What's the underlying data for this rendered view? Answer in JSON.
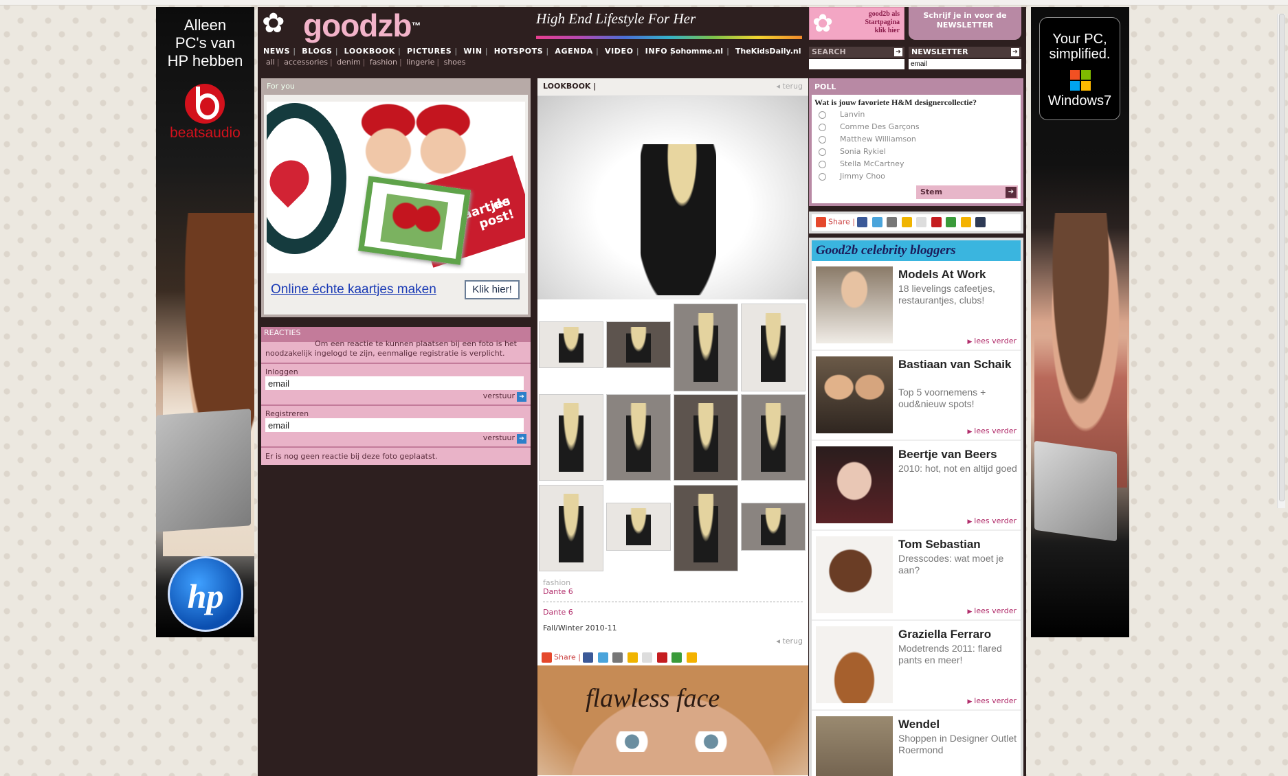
{
  "ad_left": {
    "headline": [
      "Alleen",
      "PC's van",
      "HP hebben"
    ],
    "beats_text": "beatsaudio",
    "hp_text": "hp"
  },
  "ad_right": {
    "line1": [
      "Your PC,",
      "simplified."
    ],
    "line2": "Windows7"
  },
  "header": {
    "logo": "goodzb",
    "logo_tm": "™",
    "tagline": "High End Lifestyle For Her",
    "nav": [
      "NEWS",
      "BLOGS",
      "LOOKBOOK",
      "PICTURES",
      "WIN",
      "HOTSPOTS",
      "AGENDA",
      "VIDEO",
      "INFO"
    ],
    "subnav": [
      "all",
      "accessories",
      "denim",
      "fashion",
      "lingerie",
      "shoes"
    ],
    "nav_right": [
      "Sohomme.nl",
      "TheKidsDaily.nl"
    ],
    "promo_start": [
      "good2b als",
      "Startpagina",
      "klik hier"
    ],
    "promo_newsletter": [
      "Schrijf je in voor de",
      "NEWSLETTER"
    ],
    "search_label": "SEARCH",
    "newsletter_label": "NEWSLETTER",
    "newsletter_value": "email"
  },
  "left": {
    "foryou_title": "For you",
    "card_text": [
      "kaartjes",
      "de post!"
    ],
    "ad_link": "Online échte kaartjes maken",
    "ad_button": "Klik hier!",
    "reacties_title": "REACTIES",
    "reacties_msg_right": "Om een reactie te kunnen plaatsen bij een foto is het",
    "reacties_msg_rest": "noodzakelijk ingelogd te zijn, eenmalige registratie is verplicht.",
    "login_label": "Inloggen",
    "login_value": "email",
    "login_send": "verstuur",
    "register_label": "Registreren",
    "register_value": "email",
    "register_send": "verstuur",
    "no_reactions": "Er is nog geen reactie bij deze foto geplaatst."
  },
  "middle": {
    "title": "LOOKBOOK |",
    "back": "terug",
    "category": "fashion",
    "link1": "Dante 6",
    "link2": "Dante 6",
    "season": "Fall/Winter 2010-11",
    "back2": "terug",
    "share_label": "Share",
    "flawless_title": "flawless face"
  },
  "right": {
    "poll_title": "POLL",
    "poll_question": "Wat is jouw favoriete H&M designercollectie?",
    "poll_options": [
      "Lanvin",
      "Comme Des Garçons",
      "Matthew Williamson",
      "Sonia Rykiel",
      "Stella McCartney",
      "Jimmy Choo"
    ],
    "poll_vote": "Stem",
    "share_label": "Share",
    "bloggers_banner": "Good2b celebrity bloggers",
    "read_more": "lees verder",
    "bloggers": [
      {
        "name": "Models At Work",
        "desc": "18 lievelings cafeetjes, restaurantjes, clubs!"
      },
      {
        "name": "Bastiaan van Schaik",
        "desc": "Top 5 voornemens + oud&nieuw spots!"
      },
      {
        "name": "Beertje van Beers",
        "desc": "2010: hot, not en altijd goed"
      },
      {
        "name": "Tom Sebastian",
        "desc": "Dresscodes: wat moet je aan?"
      },
      {
        "name": "Graziella Ferraro",
        "desc": "Modetrends 2011: flared pants en meer!"
      },
      {
        "name": "Wendel",
        "desc": "Shoppen in Designer Outlet Roermond"
      }
    ]
  },
  "colors": {
    "site_bg": "#2d1f1f",
    "pink": "#e9b3c8",
    "mauve": "#b889a4",
    "blue_banner": "#3ab5df",
    "link_purple": "#b12c6a"
  }
}
